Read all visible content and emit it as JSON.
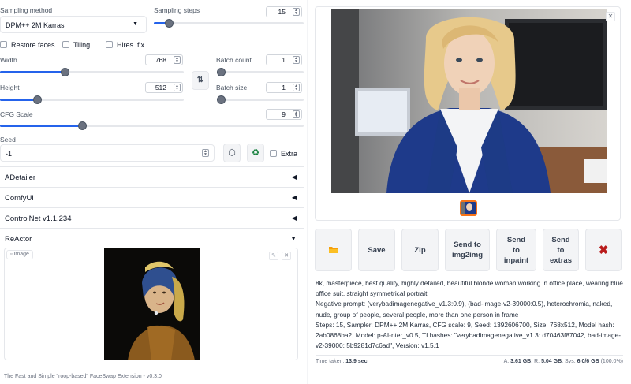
{
  "sampling": {
    "method_label": "Sampling method",
    "method_value": "DPM++ 2M Karras",
    "steps_label": "Sampling steps",
    "steps_value": "15",
    "steps_fraction": 0.1
  },
  "checkboxes": {
    "restore_faces": "Restore faces",
    "tiling": "Tiling",
    "hires_fix": "Hires. fix"
  },
  "width": {
    "label": "Width",
    "value": "768",
    "fraction": 0.35
  },
  "height": {
    "label": "Height",
    "value": "512",
    "fraction": 0.2
  },
  "batch_count": {
    "label": "Batch count",
    "value": "1",
    "fraction": 0.0
  },
  "batch_size": {
    "label": "Batch size",
    "value": "1",
    "fraction": 0.0
  },
  "cfg": {
    "label": "CFG Scale",
    "value": "9",
    "fraction": 0.27
  },
  "seed": {
    "label": "Seed",
    "value": "-1",
    "extra_label": "Extra"
  },
  "swap_icon": "swap-dimensions-icon",
  "accordions": {
    "adetailer": "ADetailer",
    "comfyui": "ComfyUI",
    "controlnet": "ControlNet v1.1.234",
    "reactor": "ReActor"
  },
  "reactor": {
    "image_label": "Image",
    "footer": "The Fast and Simple \"roop-based\" FaceSwap Extension - v0.3.0"
  },
  "actions": {
    "folder": "folder-icon",
    "save": "Save",
    "zip": "Zip",
    "img2img": [
      "Send to",
      "img2img"
    ],
    "inpaint": [
      "Send",
      "to",
      "inpaint"
    ],
    "extras": [
      "Send",
      "to",
      "extras"
    ],
    "delete": "delete-icon"
  },
  "generation_info": {
    "prompt": "8k, masterpiece, best quality, highly detailed, beautiful blonde woman working in office place, wearing blue office suit, straight symmetrical portrait",
    "negative": "Negative prompt: (verybadimagenegative_v1.3:0.9), (bad-image-v2-39000:0.5), heterochromia, naked, nude, group of people, several people, more than one person in frame",
    "params": "Steps: 15, Sampler: DPM++ 2M Karras, CFG scale: 9, Seed: 1392606700, Size: 768x512, Model hash: 2ab0868ba2, Model: p-AI-nter_v0.5, TI hashes: \"verybadimagenegative_v1.3: d70463f87042, bad-image-v2-39000: 5b9281d7c6ad\", Version: v1.5.1"
  },
  "stats": {
    "time_label": "Time taken:",
    "time_value": "13.9 sec.",
    "a_label": "A:",
    "a_value": "3.61 GB",
    "r_label": "R:",
    "r_value": "5.04 GB",
    "sys_label": "Sys:",
    "sys_value": "6.0/6 GB",
    "sys_pct": "(100.0%)"
  },
  "colors": {
    "accent": "#2563eb",
    "suit": "#1e3a8a",
    "delete": "#b91c1c"
  }
}
